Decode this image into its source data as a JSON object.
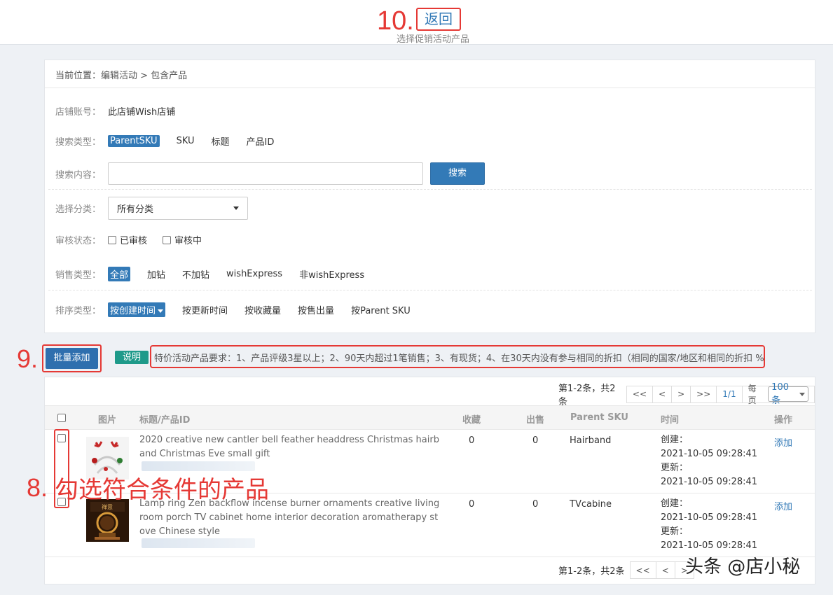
{
  "annotations": {
    "step10": "10.",
    "step9": "9.",
    "step8": "8.",
    "step8_text": "勾选符合条件的产品"
  },
  "header": {
    "back_label": "返回",
    "subtitle": "选择促销活动产品"
  },
  "breadcrumb": "当前位置：编辑活动 > 包含产品",
  "filters": {
    "shop_label": "店铺账号：",
    "shop_value": "此店铺Wish店铺",
    "search_type_label": "搜索类型：",
    "search_types": [
      "ParentSKU",
      "SKU",
      "标题",
      "产品ID"
    ],
    "search_content_label": "搜索内容：",
    "search_button": "搜索",
    "category_label": "选择分类：",
    "category_value": "所有分类",
    "review_label": "审核状态：",
    "review_options": [
      "已审核",
      "审核中"
    ],
    "sale_type_label": "销售类型：",
    "sale_types": [
      "全部",
      "加钻",
      "不加钻",
      "wishExpress",
      "非wishExpress"
    ],
    "sort_label": "排序类型：",
    "sort_options": [
      "按创建时间",
      "按更新时间",
      "按收藏量",
      "按售出量",
      "按Parent SKU"
    ]
  },
  "actions": {
    "bulk_add": "批量添加",
    "note_badge": "说明",
    "note_text": "特价活动产品要求：1、产品评级3星以上；2、90天内超过1笔销售；3、有现货；4、在30天内没有参与相同的折扣（相同的国家/地区和相同的折扣 %）"
  },
  "pager": {
    "summary": "第1-2条，共2条",
    "first": "<<",
    "prev": "<",
    "next": ">",
    "last": ">>",
    "current": "1/1",
    "per_page_label": "每页",
    "per_page_value": "100条"
  },
  "table": {
    "headers": [
      "图片",
      "标题/产品ID",
      "收藏",
      "出售",
      "Parent SKU",
      "时间",
      "操作"
    ],
    "rows": [
      {
        "title": "2020 creative new cantler bell feather headdress Christmas hairband Christmas Eve small gift",
        "favorites": "0",
        "sold": "0",
        "parent_sku": "Hairband",
        "created_label": "创建：",
        "created": "2021-10-05 09:28:41",
        "updated_label": "更新：",
        "updated": "2021-10-05 09:28:41",
        "action": "添加"
      },
      {
        "title": "Lamp ring Zen backflow incense burner ornaments creative living room porch TV cabinet home interior decoration aromatherapy stove Chinese style",
        "favorites": "0",
        "sold": "0",
        "parent_sku": "TVcabine",
        "created_label": "创建：",
        "created": "2021-10-05 09:28:41",
        "updated_label": "更新：",
        "updated": "2021-10-05 09:28:41",
        "action": "添加"
      }
    ]
  },
  "watermark": "头条 @店小秘",
  "colors": {
    "primary": "#337ab7",
    "annotation_red": "#e53935",
    "note_green": "#1e9a8a"
  }
}
